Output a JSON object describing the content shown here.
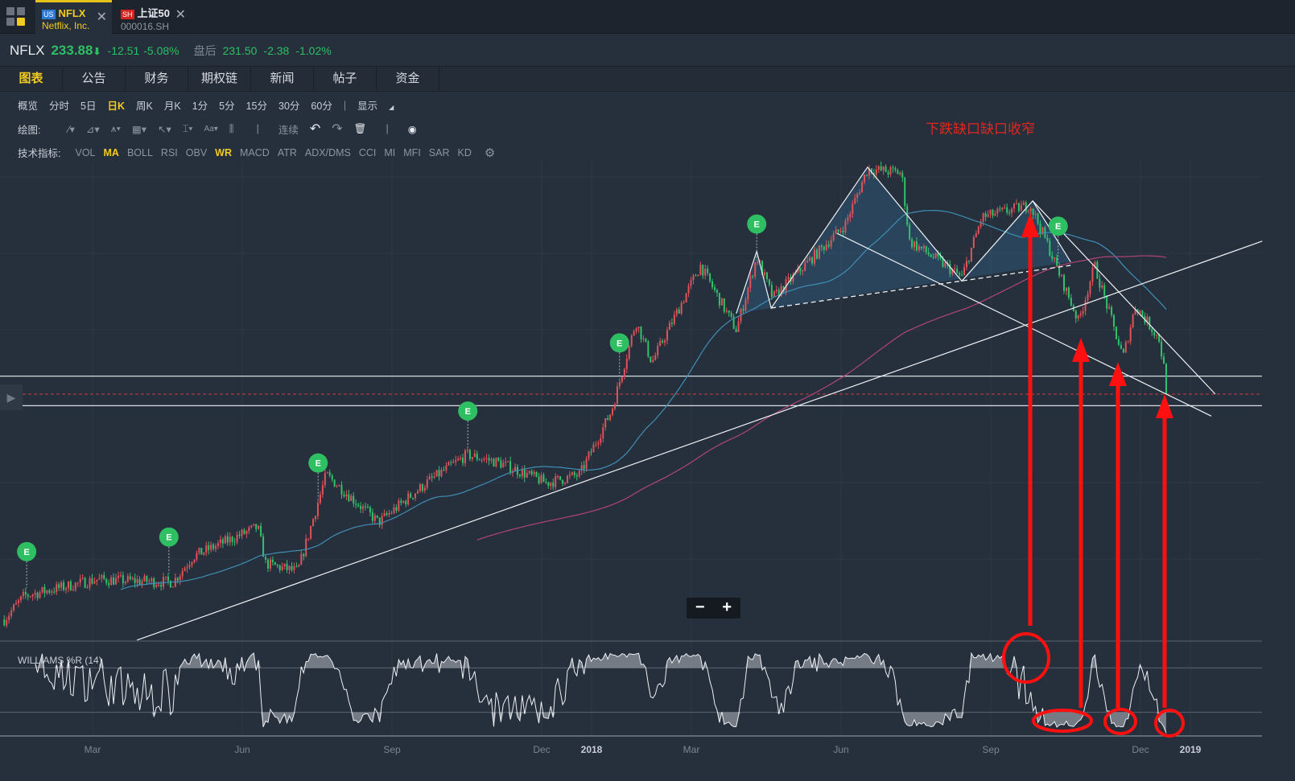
{
  "tabs": [
    {
      "market": "US",
      "symbol": "NFLX",
      "name": "Netflix, Inc.",
      "badge_color": "#2f7ad6",
      "active": true
    },
    {
      "market": "SH",
      "symbol": "上证50",
      "name": "000016.SH",
      "badge_color": "#d8201f",
      "active": false
    }
  ],
  "quote": {
    "symbol": "NFLX",
    "price": "233.88",
    "arrow": "⬇",
    "change": "-12.51",
    "change_pct": "-5.08%",
    "after_label": "盘后",
    "after_price": "231.50",
    "after_change": "-2.38",
    "after_change_pct": "-1.02%"
  },
  "nav": [
    "图表",
    "公告",
    "财务",
    "期权链",
    "新闻",
    "帖子",
    "资金"
  ],
  "periods": [
    "概览",
    "分时",
    "5日",
    "日K",
    "周K",
    "月K",
    "1分",
    "5分",
    "15分",
    "30分",
    "60分"
  ],
  "active_period": "日K",
  "display_label": "显示",
  "draw_label": "绘图:",
  "continuous_label": "连续",
  "indicators_label": "技术指标:",
  "indicators": [
    "VOL",
    "MA",
    "BOLL",
    "RSI",
    "OBV",
    "WR",
    "MACD",
    "ATR",
    "ADX/DMS",
    "CCI",
    "MI",
    "MFI",
    "SAR",
    "KD"
  ],
  "active_indicators": [
    "MA",
    "WR"
  ],
  "annotation_text": "下跌缺口缺口收窄",
  "zoom": {
    "minus": "−",
    "plus": "+"
  },
  "chart_data": {
    "type": "candlestick",
    "scale": "log",
    "x_unit": "months since Jan 2017",
    "last_price": 233.88,
    "price_path": [
      [
        0.23,
        130.8
      ],
      [
        0.63,
        139
      ],
      [
        2.08,
        145
      ],
      [
        3.61,
        144
      ],
      [
        4.02,
        154
      ],
      [
        5.31,
        166
      ],
      [
        5.47,
        151
      ],
      [
        6.11,
        148
      ],
      [
        6.68,
        190
      ],
      [
        7.73,
        168
      ],
      [
        8.69,
        186
      ],
      [
        9.5,
        200
      ],
      [
        10.15,
        196
      ],
      [
        11.1,
        186
      ],
      [
        11.76,
        190
      ],
      [
        12.4,
        224
      ],
      [
        12.89,
        282
      ],
      [
        13.21,
        254
      ],
      [
        14.18,
        326
      ],
      [
        14.9,
        276
      ],
      [
        15.31,
        333
      ],
      [
        15.63,
        300
      ],
      [
        17.08,
        362
      ],
      [
        17.53,
        418
      ],
      [
        18.21,
        414
      ],
      [
        18.37,
        347
      ],
      [
        18.85,
        333
      ],
      [
        19.42,
        316
      ],
      [
        19.82,
        369
      ],
      [
        20.79,
        381
      ],
      [
        21.11,
        347
      ],
      [
        21.76,
        282
      ],
      [
        22.08,
        326
      ],
      [
        22.65,
        257
      ],
      [
        22.9,
        294
      ],
      [
        23.37,
        270
      ],
      [
        23.56,
        233.88
      ]
    ],
    "moving_averages": [
      {
        "name": "MA50",
        "period": 50,
        "color": "#3f8fb5"
      },
      {
        "name": "MA200",
        "period": 200,
        "color": "#b0457a"
      }
    ],
    "earnings_markers": [
      {
        "month": 0.68,
        "label": "E"
      },
      {
        "month": 3.53,
        "label": "E"
      },
      {
        "month": 6.52,
        "label": "E"
      },
      {
        "month": 9.52,
        "label": "E"
      },
      {
        "month": 12.56,
        "label": "E"
      },
      {
        "month": 15.31,
        "label": "E"
      },
      {
        "month": 21.35,
        "label": "E"
      }
    ],
    "horizontal_levels": [
      245,
      227
    ],
    "trendlines": [
      [
        [
          2.89,
          124
        ],
        [
          25.44,
          347
        ]
      ],
      [
        [
          16.92,
          354
        ],
        [
          24.42,
          221
        ]
      ],
      [
        [
          20.84,
          385
        ],
        [
          24.5,
          233.88
        ]
      ]
    ],
    "neckline": [
      [
        15.6,
        292
      ],
      [
        21.6,
        326
      ]
    ],
    "pattern": [
      [
        14.9,
        288
      ],
      [
        15.31,
        338
      ],
      [
        15.6,
        292
      ],
      [
        17.53,
        420
      ],
      [
        19.42,
        313
      ],
      [
        20.84,
        385
      ],
      [
        21.6,
        329
      ]
    ],
    "indicator": {
      "name": "WILLIAMS %R (14)",
      "period": 14,
      "levels": [
        -20,
        -80
      ]
    },
    "x_ticks": [
      {
        "label": "Mar",
        "month": 2
      },
      {
        "label": "Jun",
        "month": 5
      },
      {
        "label": "Sep",
        "month": 8
      },
      {
        "label": "Dec",
        "month": 11
      },
      {
        "label": "2018",
        "month": 12,
        "bold": true
      },
      {
        "label": "Mar",
        "month": 14
      },
      {
        "label": "Jun",
        "month": 17
      },
      {
        "label": "Sep",
        "month": 20
      },
      {
        "label": "Dec",
        "month": 23
      },
      {
        "label": "2019",
        "month": 24,
        "bold": true
      }
    ],
    "colors": {
      "up": "#e0525a",
      "down": "#31c26b",
      "marker": "#2fbf63",
      "annotation": "#ff1010"
    }
  }
}
